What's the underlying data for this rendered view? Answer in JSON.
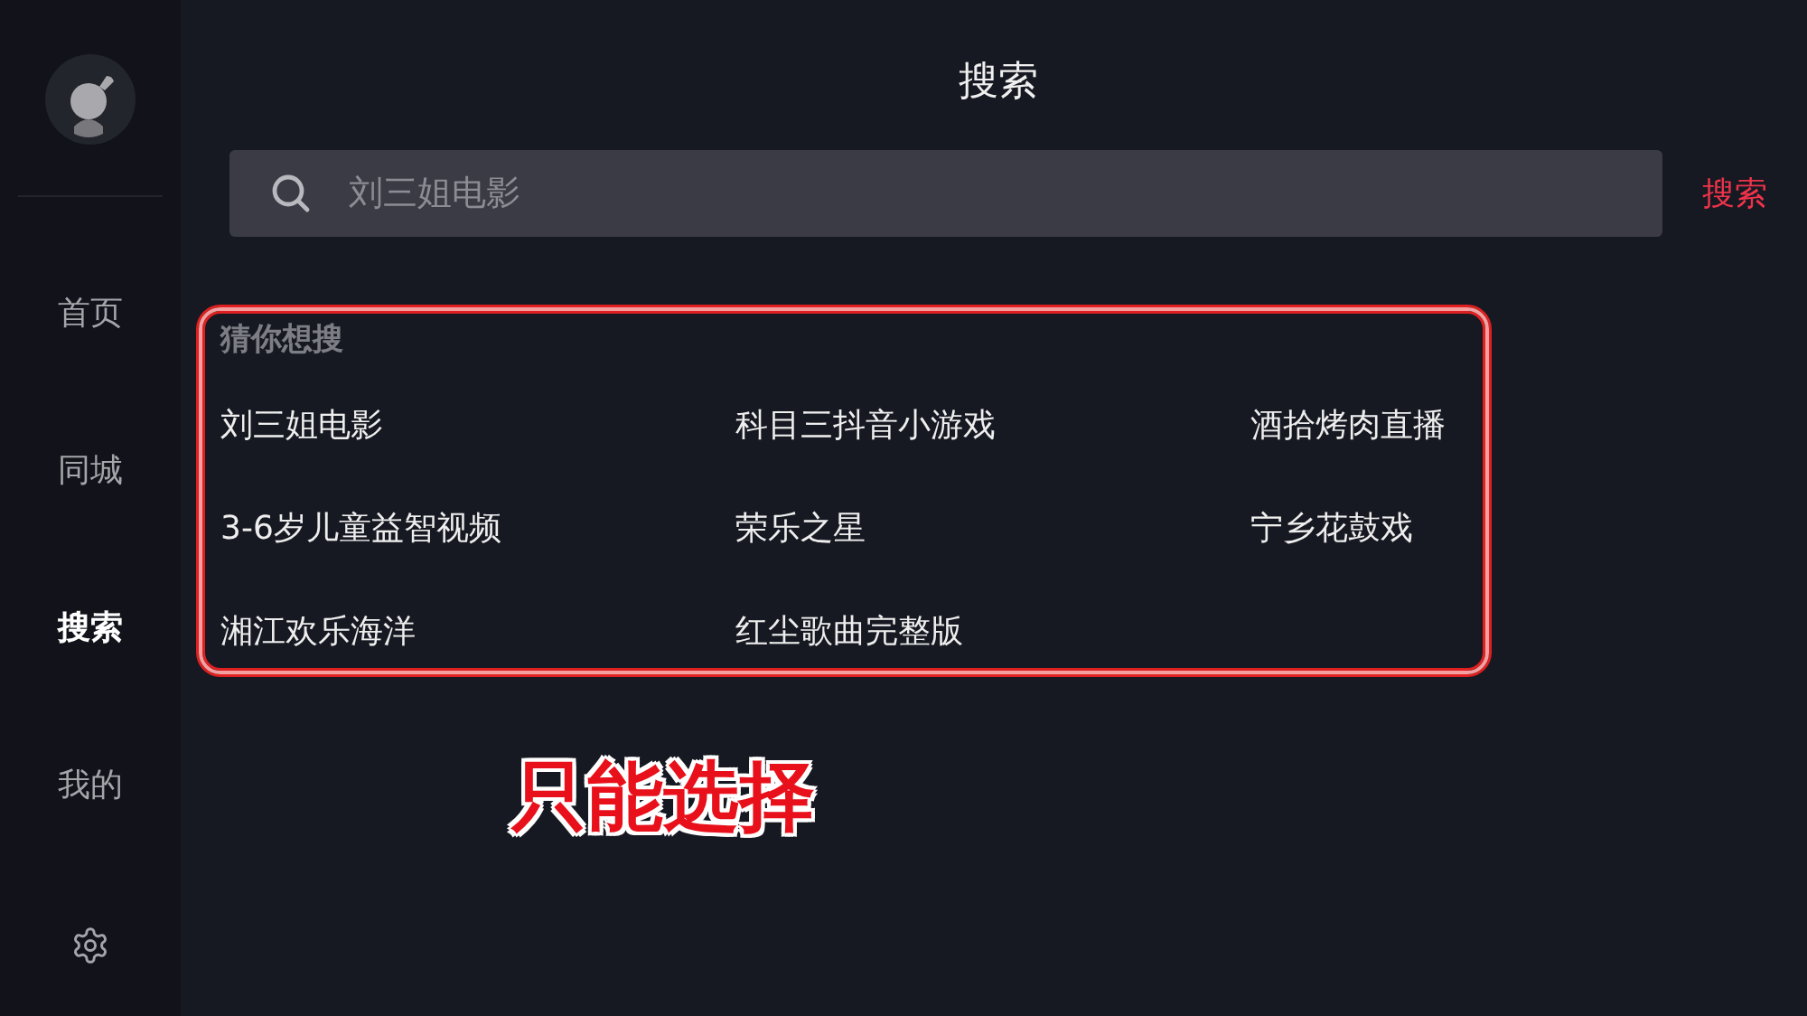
{
  "sidebar": {
    "items": [
      {
        "label": "首页",
        "selected": false
      },
      {
        "label": "同城",
        "selected": false
      },
      {
        "label": "搜索",
        "selected": true
      },
      {
        "label": "我的",
        "selected": false
      }
    ]
  },
  "page_title": "搜索",
  "search": {
    "placeholder": "刘三姐电影",
    "button": "搜索"
  },
  "suggestions": {
    "heading": "猜你想搜",
    "items": [
      "刘三姐电影",
      "科目三抖音小游戏",
      "酒拾烤肉直播",
      "3-6岁儿童益智视频",
      "荣乐之星",
      "宁乡花鼓戏",
      "湘江欢乐海洋",
      "红尘歌曲完整版"
    ]
  },
  "annotation": "只能选择"
}
